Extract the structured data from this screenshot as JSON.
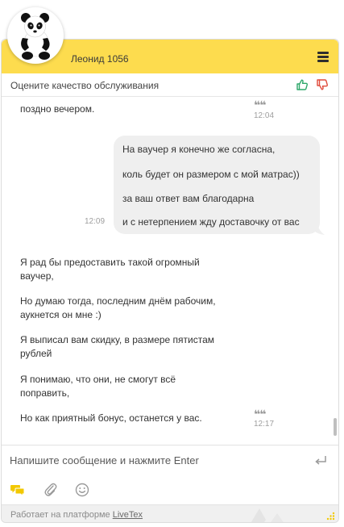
{
  "header": {
    "operator_name": "Леонид 1056",
    "color": "#fddc4e"
  },
  "rating": {
    "label": "Оцените качество обслуживания",
    "up_icon": "thumbs-up-icon",
    "down_icon": "thumbs-down-icon",
    "up_color": "#2fa86b",
    "down_color": "#e04a3a"
  },
  "messages": {
    "first": {
      "line_partial": "поздно вечером.",
      "time": "12:04"
    },
    "client": {
      "lines": [
        "На ваучер я конечно же согласна,",
        "коль будет он размером с мой матрас))",
        "за ваш ответ вам благодарна",
        "и с нетерпением жду доставочку от вас"
      ],
      "time": "12:09"
    },
    "operator": {
      "paragraphs": [
        [
          "Я рад бы предоставить такой огромный",
          "ваучер,"
        ],
        [
          "Но думаю тогда, последним днём рабочим,",
          "аукнется он мне :)"
        ],
        [
          "Я выписал вам скидку, в размере пятистам",
          "рублей"
        ],
        [
          "Я понимаю, что они, не смогут всё",
          "поправить,"
        ],
        [
          "Но как приятный бонус, останется у вас."
        ]
      ],
      "time": "12:17"
    }
  },
  "input": {
    "placeholder": "Напишите сообщение и нажмите Enter"
  },
  "tools": {
    "chat_icon": "chat-bubbles-icon",
    "attach_icon": "paperclip-icon",
    "emoji_icon": "smiley-icon"
  },
  "footer": {
    "text": "Работает на платформе",
    "link": "LiveTex"
  }
}
